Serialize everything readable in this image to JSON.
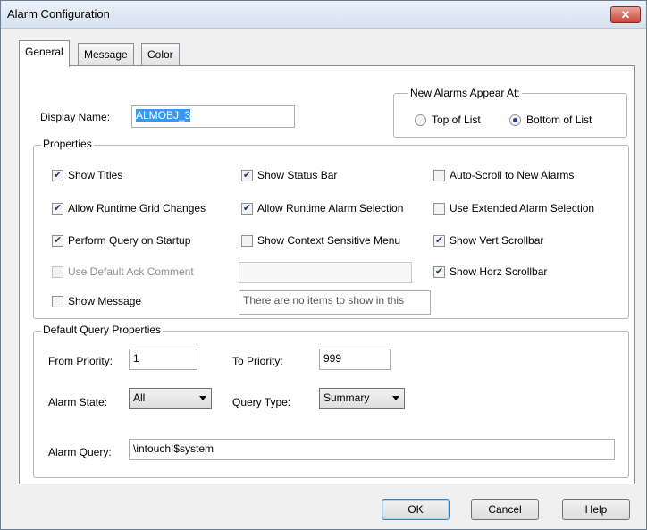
{
  "window": {
    "title": "Alarm Configuration",
    "close_glyph": "✕"
  },
  "tabs": {
    "general": "General",
    "message": "Message",
    "color": "Color"
  },
  "display_name": {
    "label": "Display Name:",
    "value": "ALMOBJ_3"
  },
  "new_alarms": {
    "legend": "New Alarms Appear At:",
    "top_label": "Top of List",
    "bottom_label": "Bottom of List",
    "selected": "bottom"
  },
  "properties": {
    "legend": "Properties",
    "show_titles": {
      "label": "Show Titles",
      "checked": true
    },
    "show_status_bar": {
      "label": "Show Status Bar",
      "checked": true
    },
    "auto_scroll": {
      "label": "Auto-Scroll to New Alarms",
      "checked": false
    },
    "allow_grid": {
      "label": "Allow Runtime Grid Changes",
      "checked": true
    },
    "allow_selection": {
      "label": "Allow Runtime Alarm Selection",
      "checked": true
    },
    "extended_selection": {
      "label": "Use Extended Alarm Selection",
      "checked": false
    },
    "perform_query": {
      "label": "Perform Query on Startup",
      "checked": true
    },
    "context_menu": {
      "label": "Show Context Sensitive Menu",
      "checked": false
    },
    "vert_scrollbar": {
      "label": "Show Vert Scrollbar",
      "checked": true
    },
    "default_ack": {
      "label": "Use Default Ack Comment",
      "checked": false,
      "value": ""
    },
    "horz_scrollbar": {
      "label": "Show Horz Scrollbar",
      "checked": true
    },
    "show_message": {
      "label": "Show Message",
      "checked": false
    },
    "message_list_text": "There are no items to show in this"
  },
  "query": {
    "legend": "Default Query Properties",
    "from_priority_label": "From Priority:",
    "from_priority": "1",
    "to_priority_label": "To Priority:",
    "to_priority": "999",
    "alarm_state_label": "Alarm State:",
    "alarm_state": "All",
    "query_type_label": "Query Type:",
    "query_type": "Summary",
    "alarm_query_label": "Alarm Query:",
    "alarm_query": "\\intouch!$system"
  },
  "buttons": {
    "ok": "OK",
    "cancel": "Cancel",
    "help": "Help"
  }
}
